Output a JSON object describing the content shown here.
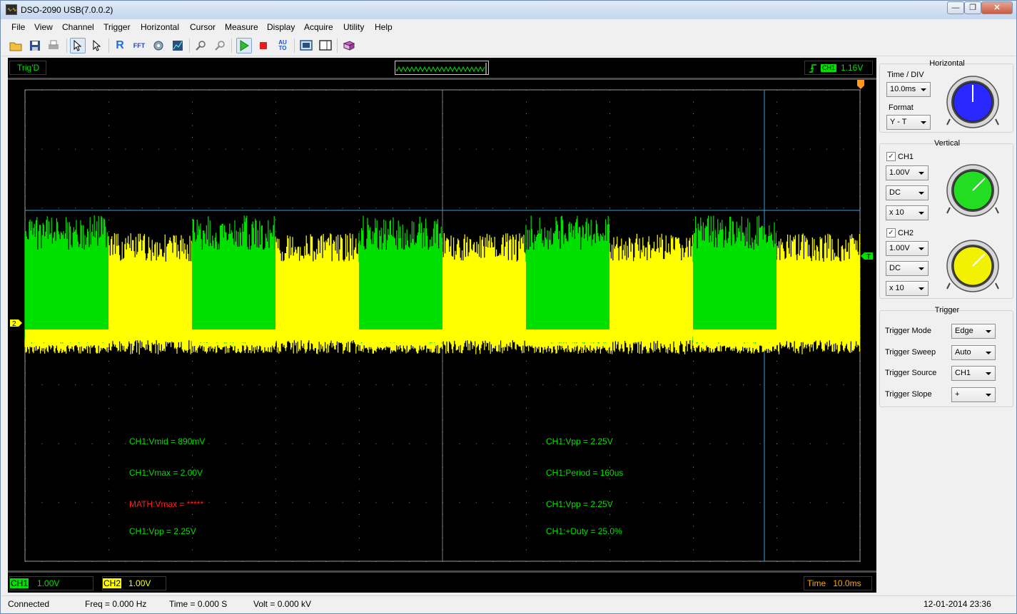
{
  "window": {
    "title": "DSO-2090 USB(7.0.0.2)",
    "min": "—",
    "max": "❐",
    "close": "✕"
  },
  "menu": [
    "File",
    "View",
    "Channel",
    "Trigger",
    "Horizontal",
    "Cursor",
    "Measure",
    "Display",
    "Acquire",
    "Utility",
    "Help"
  ],
  "toolbar": {
    "icons": [
      "open-icon",
      "save-icon",
      "print-icon",
      "select-pointer-icon",
      "pointer-icon",
      "r-icon",
      "fft-icon",
      "settings-wheel-icon",
      "calibrate-icon",
      "zoom-in-icon",
      "zoom-out-icon",
      "run-icon",
      "stop-icon",
      "autoset-icon",
      "screen-icon",
      "panel-icon",
      "book-icon"
    ],
    "r_glyph": "R",
    "fft_glyph": "FFT",
    "auto_glyph": "AU\nTO"
  },
  "scope": {
    "trig_status": "Trig'D",
    "trig_channel": "CH1",
    "trig_level": "1.16V",
    "ch1_label": "CH1",
    "ch1_scale": "1.00V",
    "ch2_label": "CH2",
    "ch2_scale": "1.00V",
    "time_label": "Time",
    "time_scale": "10.0ms",
    "ch2_marker": "2",
    "trig_marker": "T",
    "colors": {
      "ch1": "#00e000",
      "ch2": "#ffff00",
      "math": "#ff2020",
      "cursor": "#3aa0d8",
      "time": "#ffa500"
    },
    "measurements_left": [
      {
        "text": "CH1:Vmid = 890mV",
        "color": "#00e000"
      },
      {
        "text": "CH1:Vmax = 2.00V",
        "color": "#00e000"
      },
      {
        "text": "MATH:Vmax = *****",
        "color": "#ff2020"
      },
      {
        "text": "CH1:Vpp = 2.25V",
        "color": "#00e000"
      }
    ],
    "measurements_right": [
      {
        "text": "CH1:Vpp = 2.25V",
        "color": "#00e000"
      },
      {
        "text": "CH1:Period = 160us",
        "color": "#00e000"
      },
      {
        "text": "CH1:Vpp = 2.25V",
        "color": "#00e000"
      },
      {
        "text": "CH1:+Duty = 25.0%",
        "color": "#00e000"
      }
    ]
  },
  "panel": {
    "horizontal": {
      "title": "Horizontal",
      "time_div_label": "Time / DIV",
      "time_div": "10.0ms",
      "format_label": "Format",
      "format": "Y - T",
      "knob_color": "#2828ff"
    },
    "vertical": {
      "title": "Vertical",
      "ch1": {
        "name": "CH1",
        "checked": "✓",
        "volts": "1.00V",
        "coupling": "DC",
        "probe": "x 10",
        "knob_color": "#22dd22"
      },
      "ch2": {
        "name": "CH2",
        "checked": "✓",
        "volts": "1.00V",
        "coupling": "DC",
        "probe": "x 10",
        "knob_color": "#f2f200"
      }
    },
    "trigger": {
      "title": "Trigger",
      "mode_label": "Trigger Mode",
      "mode": "Edge",
      "sweep_label": "Trigger Sweep",
      "sweep": "Auto",
      "source_label": "Trigger Source",
      "source": "CH1",
      "slope_label": "Trigger Slope",
      "slope": "+"
    }
  },
  "statusbar": {
    "connection": "Connected",
    "freq": "Freq = 0.000 Hz",
    "time": "Time = 0.000 S",
    "volt": "Volt = 0.000 kV",
    "datetime": "12-01-2014  23:36"
  }
}
